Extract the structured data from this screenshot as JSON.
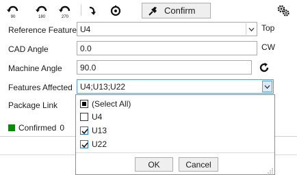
{
  "toolbar": {
    "rotate_90_label": "90",
    "rotate_180_label": "180",
    "rotate_270_label": "270",
    "confirm_label": "Confirm",
    "icons": [
      "rotate-90-icon",
      "rotate-180-icon",
      "rotate-270-icon",
      "rotate-arrow-icon",
      "target-icon",
      "pin-icon",
      "gears-icon"
    ]
  },
  "form": {
    "reference_feature": {
      "label": "Reference Feature",
      "value": "U4",
      "side": "Top"
    },
    "cad_angle": {
      "label": "CAD Angle",
      "value": "0.0",
      "side": "CW"
    },
    "machine_angle": {
      "label": "Machine Angle",
      "value": "90.0"
    },
    "features_affected": {
      "label": "Features Affected",
      "value": "U4;U13;U22"
    },
    "package_link": {
      "label": "Package Link"
    }
  },
  "status": {
    "label": "Confirmed",
    "count": "0",
    "color": "#0a8a0a"
  },
  "dropdown": {
    "items": [
      {
        "label": "(Select All)",
        "state": "partial"
      },
      {
        "label": "U4",
        "state": "unchecked"
      },
      {
        "label": "U13",
        "state": "checked"
      },
      {
        "label": "U22",
        "state": "checked"
      }
    ],
    "ok_label": "OK",
    "cancel_label": "Cancel"
  }
}
